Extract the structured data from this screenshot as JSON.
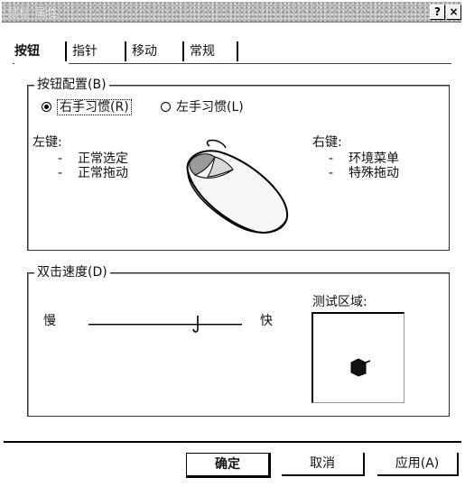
{
  "window": {
    "title": "鼠标 属性",
    "help_label": "?",
    "close_label": "×"
  },
  "tabs": [
    {
      "label": "按钮",
      "active": true
    },
    {
      "label": "指针",
      "active": false
    },
    {
      "label": "移动",
      "active": false
    },
    {
      "label": "常规",
      "active": false
    }
  ],
  "button_config": {
    "title": "按钮配置(B)",
    "right_handed": {
      "label": "右手习惯(R)",
      "checked": true
    },
    "left_handed": {
      "label": "左手习惯(L)",
      "checked": false
    },
    "left_button": {
      "heading": "左键:",
      "items": [
        "正常选定",
        "正常拖动"
      ]
    },
    "right_button": {
      "heading": "右键:",
      "items": [
        "环境菜单",
        "特殊拖动"
      ]
    },
    "bullet": "-"
  },
  "double_click": {
    "title": "双击速度(D)",
    "slow_label": "慢",
    "fast_label": "快",
    "speed_fraction": 0.7,
    "test_area_label": "测试区域:"
  },
  "buttons": {
    "ok": "确定",
    "cancel": "取消",
    "apply": "应用(A)"
  },
  "icons": {
    "mouse": "mouse-icon",
    "test_object": "jack-in-box-icon",
    "help": "help-icon",
    "close": "close-icon"
  }
}
